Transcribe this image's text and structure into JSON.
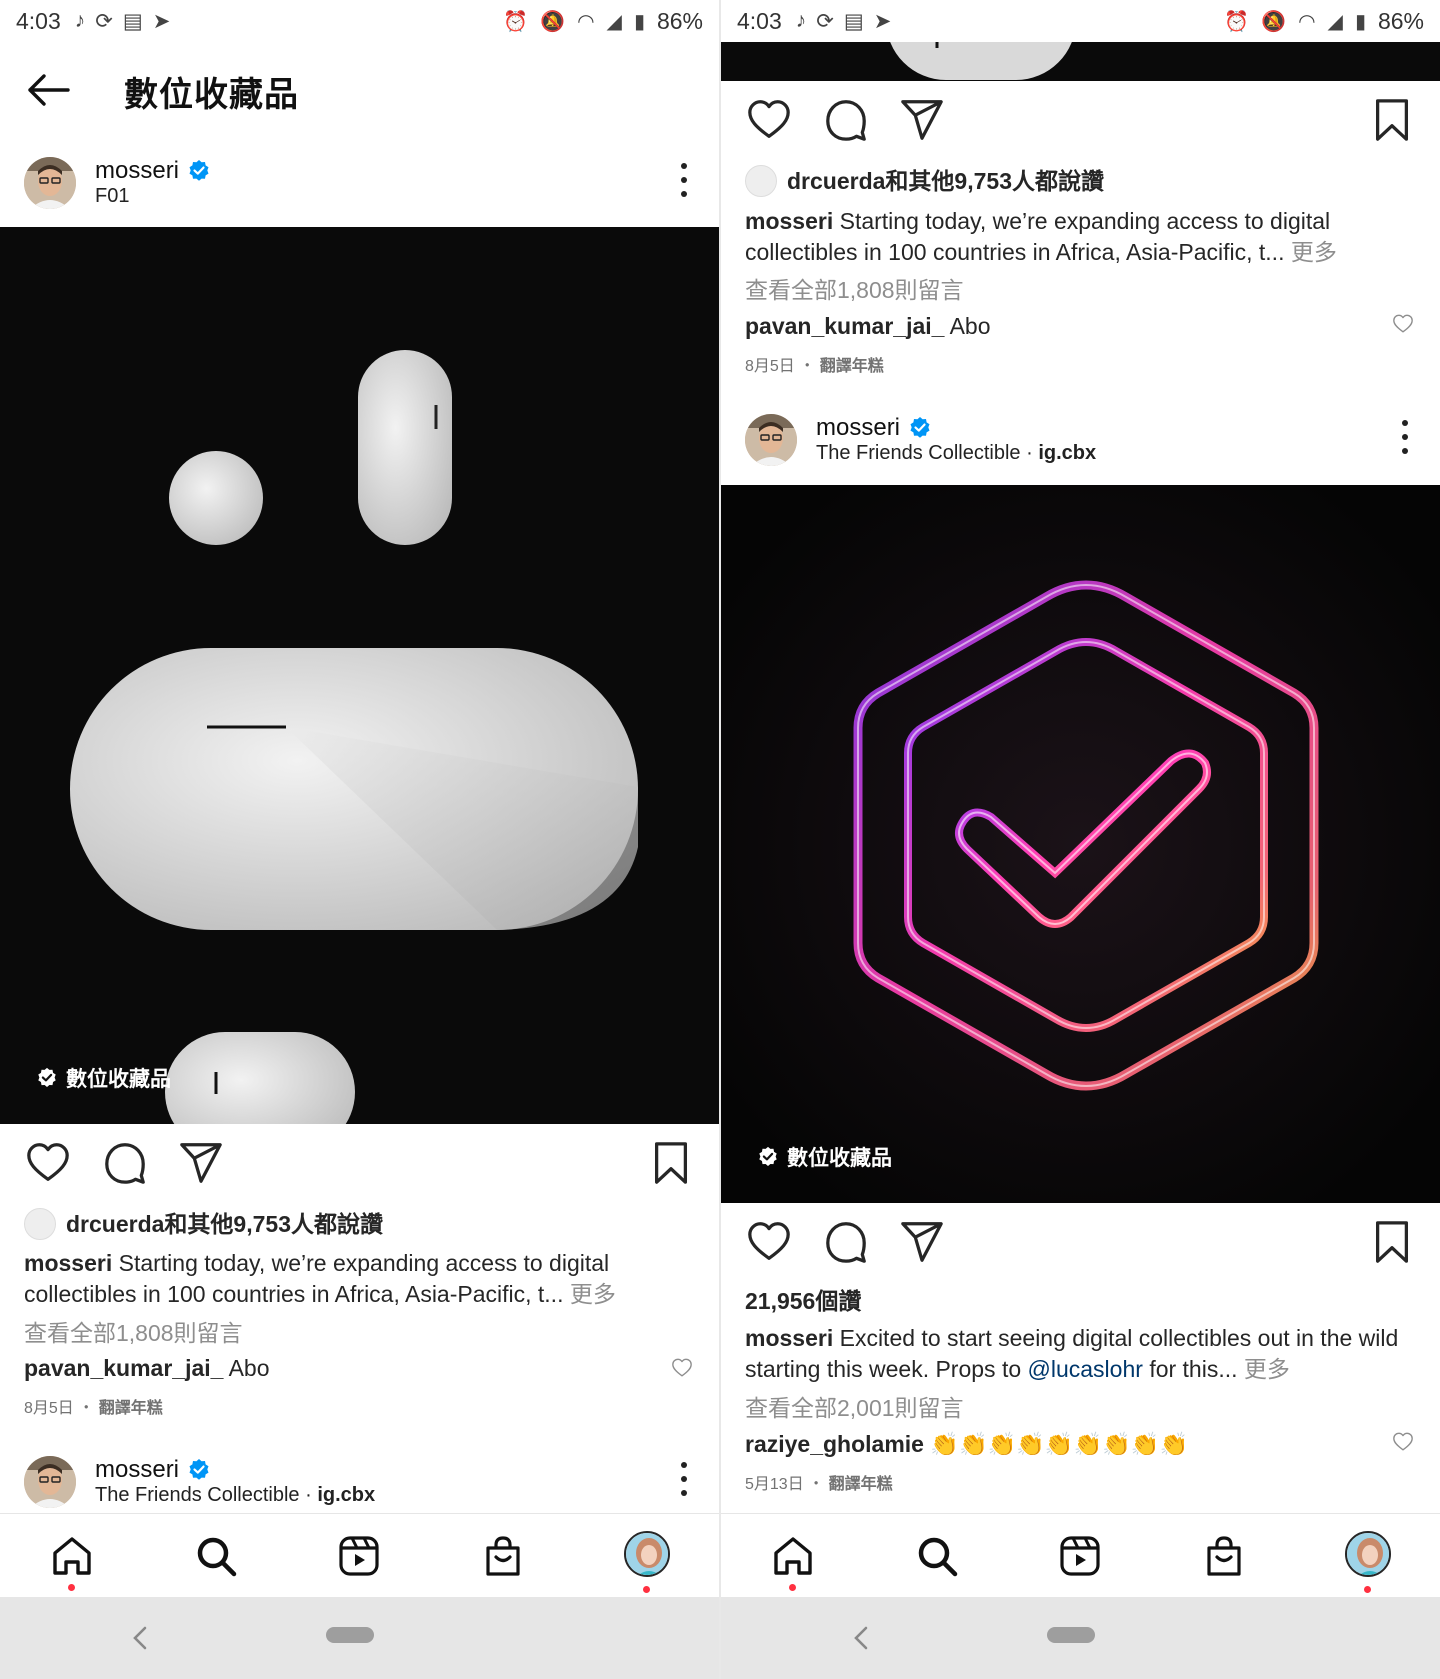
{
  "status_bar": {
    "time": "4:03",
    "battery": "86%"
  },
  "header": {
    "title": "數位收藏品"
  },
  "post1": {
    "username": "mosseri",
    "subtitle": "F01",
    "collectible_label": "數位收藏品",
    "liked_by": "drcuerda和其他9,753人都說讚",
    "caption_user": "mosseri",
    "caption_text": "Starting today, we’re expanding access to digital collectibles in 100 countries in Africa, Asia-Pacific, t...",
    "more_label": "更多",
    "view_comments": "查看全部1,808則留言",
    "comment_user": "pavan_kumar_jai_",
    "comment_text": "Abo",
    "date": "8月5日",
    "translate": "翻譯年糕"
  },
  "post2": {
    "username": "mosseri",
    "subtitle_text": "The Friends Collectible",
    "subtitle_sep": "·",
    "subtitle_audio": "ig.cbx",
    "collectible_label": "數位收藏品",
    "likes": "21,956個讚",
    "caption_user": "mosseri",
    "caption_text_1": "Excited to start seeing digital collectibles out in the wild starting this week. Props to",
    "caption_mention": "@lucaslohr",
    "caption_text_2": "for this...",
    "more_label": "更多",
    "view_comments": "查看全部2,001則留言",
    "comment_user": "raziye_gholamie",
    "comment_text": "👏👏👏👏👏👏👏👏👏",
    "date": "5月13日",
    "translate": "翻譯年糕"
  },
  "date_sep": "・",
  "icons": {
    "back": "arrow-left-icon",
    "verified": "verified-badge-icon",
    "like": "heart-icon",
    "comment": "comment-bubble-icon",
    "share": "paper-plane-icon",
    "save": "bookmark-icon",
    "more": "more-vertical-icon",
    "nav": [
      "home-icon",
      "search-icon",
      "reels-icon",
      "shop-icon",
      "profile-avatar"
    ]
  },
  "colors": {
    "verified_blue": "#0095f6",
    "notification_red": "#ff3040",
    "mention_blue": "#00376b"
  }
}
